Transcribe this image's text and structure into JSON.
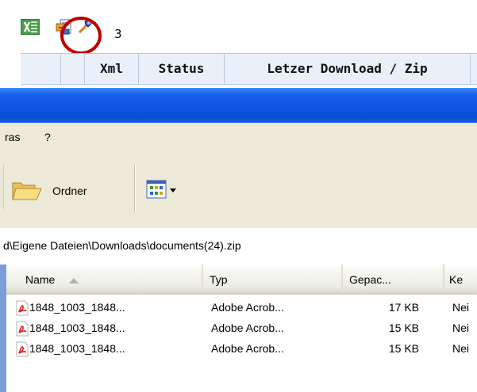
{
  "grid": {
    "icons": [
      "excel-export-icon",
      "document-export-icon",
      "settings-icon"
    ],
    "count": "3",
    "columns": [
      "Xml",
      "Status",
      "Letzer Download / Zip"
    ],
    "highlight_color": "#c00000"
  },
  "explorer": {
    "menu": [
      "ras",
      "?"
    ],
    "toolbar": {
      "folders_label": "Ordner",
      "views_icon": "views-icon"
    },
    "address": "d\\Eigene Dateien\\Downloads\\documents(24).zip",
    "columns": [
      "Name",
      "Typ",
      "Gepac...",
      "Ke"
    ],
    "files": [
      {
        "name": "1848_1003_1848...",
        "type": "Adobe Acrob...",
        "packed": "17 KB",
        "ke": "Nei"
      },
      {
        "name": "1848_1003_1848...",
        "type": "Adobe Acrob...",
        "packed": "15 KB",
        "ke": "Nei"
      },
      {
        "name": "1848_1003_1848...",
        "type": "Adobe Acrob...",
        "packed": "15 KB",
        "ke": "Nei"
      }
    ],
    "titlebar_color": "#0b54e4"
  }
}
